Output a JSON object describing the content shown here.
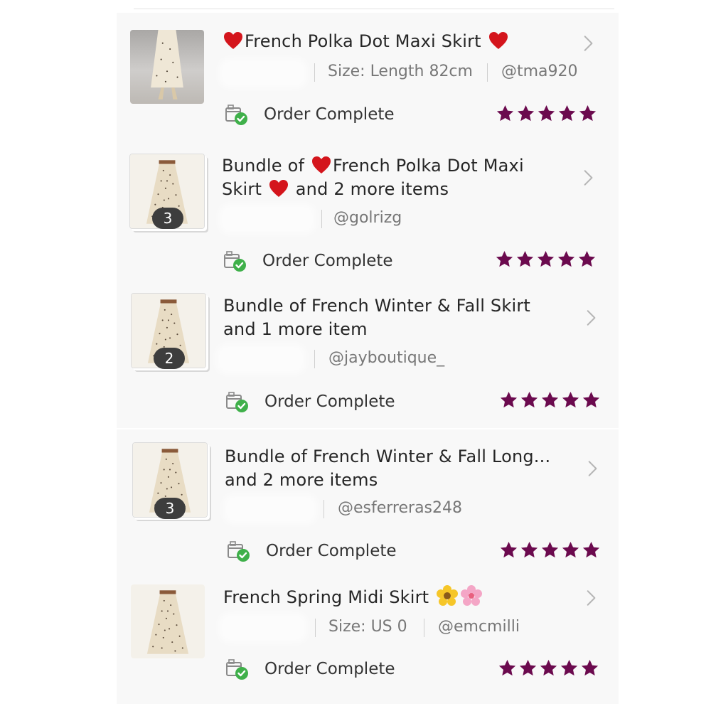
{
  "orders": [
    {
      "title_parts": [
        "French Polka Dot Maxi Skirt"
      ],
      "size": "Size: Length 82cm",
      "seller": "@tma920",
      "status": "Order Complete",
      "rating": 5,
      "thumb": "model-photo"
    },
    {
      "title_prefix": "Bundle of ",
      "title_main": "French Polka Dot Maxi",
      "title_line2_start": "Skirt ",
      "title_line2_end": " and 2 more items",
      "seller": "@golrizg",
      "count": "3",
      "status": "Order Complete",
      "rating": 5
    },
    {
      "title_line1": "Bundle of French Winter & Fall Skirt",
      "title_line2": "and 1 more item",
      "seller": "@jayboutique_",
      "count": "2",
      "status": "Order Complete",
      "rating": 5
    },
    {
      "title_line1": "Bundle of French Winter & Fall Long...",
      "title_line2": "and 2 more items",
      "seller": "@esferreras248",
      "count": "3",
      "status": "Order Complete",
      "rating": 5
    },
    {
      "title_line1": "French Spring Midi Skirt",
      "size": "Size: US 0",
      "seller": "@emcmilli",
      "status": "Order Complete",
      "rating": 5
    }
  ],
  "colors": {
    "star": "#6b0a4e",
    "check": "#3fb04a",
    "heart": "#d4151c"
  },
  "icons": {
    "chevron": "chevron-right-icon",
    "status": "package-check-icon",
    "star": "star-icon",
    "heart": "heart-emoji-icon",
    "flowers": "flower-emoji-icon"
  }
}
